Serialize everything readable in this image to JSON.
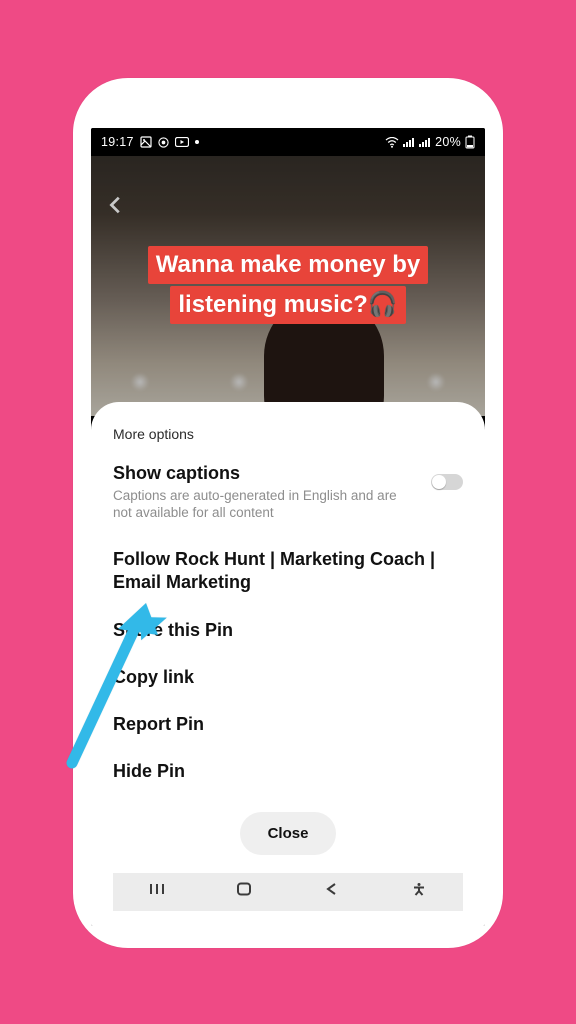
{
  "statusbar": {
    "time": "19:17",
    "battery_text": "20%"
  },
  "video": {
    "caption_line1": "Wanna make money by",
    "caption_line2": "listening music?🎧"
  },
  "sheet": {
    "title": "More options",
    "captions": {
      "headline": "Show captions",
      "sub": "Captions are auto-generated in English and are not available for all content",
      "toggled": false
    },
    "follow_label": "Follow Rock Hunt | Marketing Coach | Email Marketing",
    "share_label": "Share this Pin",
    "copy_label": "Copy link",
    "report_label": "Report Pin",
    "hide_label": "Hide Pin",
    "close_label": "Close"
  }
}
